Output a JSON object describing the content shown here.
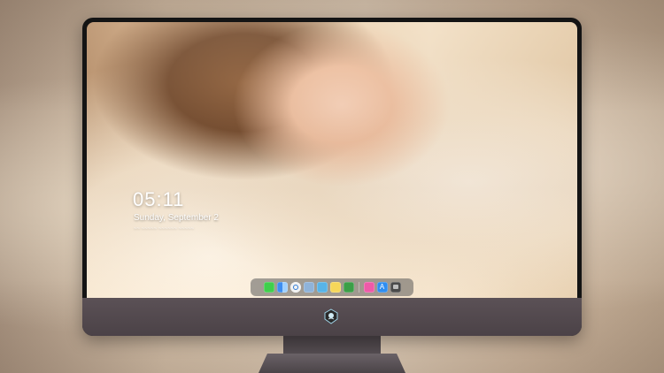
{
  "lockscreen": {
    "time": "05:11",
    "date": "Sunday, September 2",
    "sub_text": "~~ ~~~~~ ~~~~~~ ~~~~~"
  },
  "dock": {
    "icons": [
      "messages-icon",
      "finder-icon",
      "safari-icon",
      "preview-icon",
      "imovie-icon",
      "notes-icon",
      "numbers-icon",
      "music-icon",
      "app-store-icon",
      "camera-icon"
    ]
  },
  "colors": {
    "monitor_bezel": "#141414",
    "chin": "#4b4247",
    "dock_background": "rgba(90,90,90,0.55)"
  }
}
